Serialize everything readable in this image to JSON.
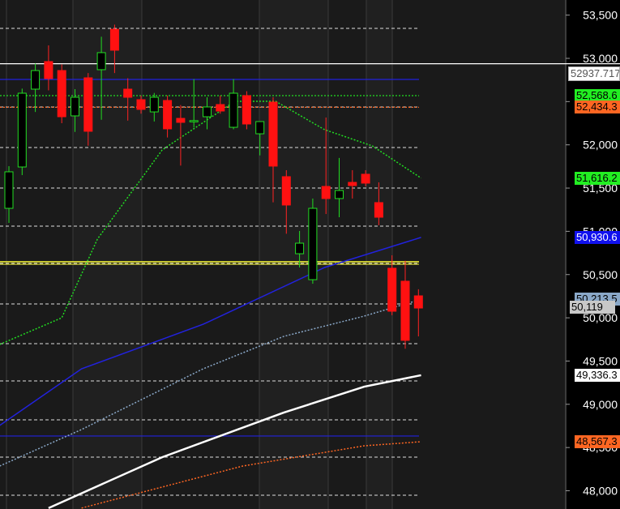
{
  "chart_data": {
    "type": "candlestick",
    "y_axis": {
      "ticks": [
        53500,
        53000,
        52500,
        52000,
        51500,
        51000,
        50500,
        50000,
        49500,
        49000,
        48500,
        48000
      ],
      "tick_labels": [
        "53,500",
        "53,000",
        "52,500",
        "52,000",
        "51,500",
        "51,000",
        "50,500",
        "50,000",
        "49,500",
        "49,000",
        "48,500",
        "48,000"
      ],
      "range": [
        47800,
        53650
      ]
    },
    "candles": [
      [
        51266,
        51754,
        51097,
        51688
      ],
      [
        51744,
        52650,
        51650,
        52597
      ],
      [
        52644,
        52940,
        52380,
        52859
      ],
      [
        52963,
        53150,
        52630,
        52766
      ],
      [
        52859,
        52930,
        52250,
        52325
      ],
      [
        52335,
        52644,
        52150,
        52550
      ],
      [
        52775,
        52830,
        51990,
        52157
      ],
      [
        52869,
        53250,
        52290,
        53066
      ],
      [
        53337,
        53390,
        52830,
        53094
      ],
      [
        52644,
        52770,
        52280,
        52550
      ],
      [
        52522,
        52570,
        52360,
        52410
      ],
      [
        52381,
        52600,
        52270,
        52550
      ],
      [
        52513,
        52570,
        52085,
        52185
      ],
      [
        52306,
        52460,
        51760,
        52260
      ],
      [
        52270,
        52760,
        52200,
        52280
      ],
      [
        52325,
        52550,
        52180,
        52438
      ],
      [
        52466,
        52570,
        52360,
        52391
      ],
      [
        52203,
        52760,
        52180,
        52597
      ],
      [
        52569,
        52620,
        52180,
        52241
      ],
      [
        52128,
        52222,
        51878,
        52269
      ],
      [
        52494,
        52550,
        51335,
        51754
      ],
      [
        51632,
        51707,
        50972,
        51304
      ],
      [
        50741,
        51004,
        50582,
        50863
      ],
      [
        50441,
        51379,
        50394,
        51266
      ],
      [
        51519,
        52316,
        51200,
        51379
      ],
      [
        51379,
        51848,
        51163,
        51472
      ],
      [
        51566,
        51707,
        51379,
        51529
      ],
      [
        51660,
        51707,
        51520,
        51557
      ],
      [
        51332,
        51566,
        51070,
        51163
      ],
      [
        50573,
        50723,
        50030,
        50076
      ],
      [
        50423,
        50660,
        49643,
        49739
      ],
      [
        50254,
        50330,
        49785,
        50113
      ]
    ],
    "lines": [
      {
        "name": "MA short",
        "color": "#22dd22",
        "style": "dotted",
        "points": [
          [
            -0.7,
            49692
          ],
          [
            4,
            50000
          ],
          [
            6.7,
            50910
          ],
          [
            11.6,
            51941
          ],
          [
            17.1,
            52503
          ],
          [
            20.2,
            52503
          ],
          [
            23.9,
            52175
          ],
          [
            27.5,
            51988
          ],
          [
            31.2,
            51616
          ]
        ],
        "label": "51,616.2"
      },
      {
        "name": "MA blue",
        "color": "#2222dd",
        "style": "solid",
        "points": [
          [
            -0.7,
            48755
          ],
          [
            5.5,
            49410
          ],
          [
            14.7,
            49925
          ],
          [
            23.9,
            50582
          ],
          [
            31.2,
            50930
          ]
        ],
        "label": "50,930.6"
      },
      {
        "name": "MA light",
        "color": "#8aa8c8",
        "style": "dotted",
        "points": [
          [
            -0.7,
            48286
          ],
          [
            5.5,
            48708
          ],
          [
            14.7,
            49410
          ],
          [
            20.8,
            49785
          ],
          [
            26.9,
            50020
          ],
          [
            31.2,
            50213
          ]
        ],
        "label": "50,213.5"
      },
      {
        "name": "MA white",
        "color": "#ffffff",
        "style": "solid",
        "points": [
          [
            3,
            47800
          ],
          [
            11.6,
            48388
          ],
          [
            20.8,
            48904
          ],
          [
            26.9,
            49204
          ],
          [
            31.2,
            49336
          ]
        ],
        "label": "49,336.3"
      },
      {
        "name": "MA orange",
        "color": "#ff6622",
        "style": "dotted",
        "points": [
          [
            5.5,
            47800
          ],
          [
            17.7,
            48286
          ],
          [
            26.9,
            48520
          ],
          [
            31.2,
            48567
          ]
        ],
        "label": "48,567.3"
      }
    ],
    "levels": [
      {
        "value": 52937.717,
        "color": "#ffffff",
        "label": "52937.717"
      },
      {
        "value": 52756,
        "color": "#2222dd"
      },
      {
        "value": 52568.6,
        "color": "#22dd22",
        "dotted": true,
        "label": "52,568.6"
      },
      {
        "value": 52434.3,
        "color": "#ff6622",
        "dotted": true,
        "label": "52,434.3"
      },
      {
        "value": 50648,
        "color": "#ffff33"
      },
      {
        "value": 48633,
        "color": "#2222dd"
      }
    ],
    "last_price": "50,119"
  }
}
